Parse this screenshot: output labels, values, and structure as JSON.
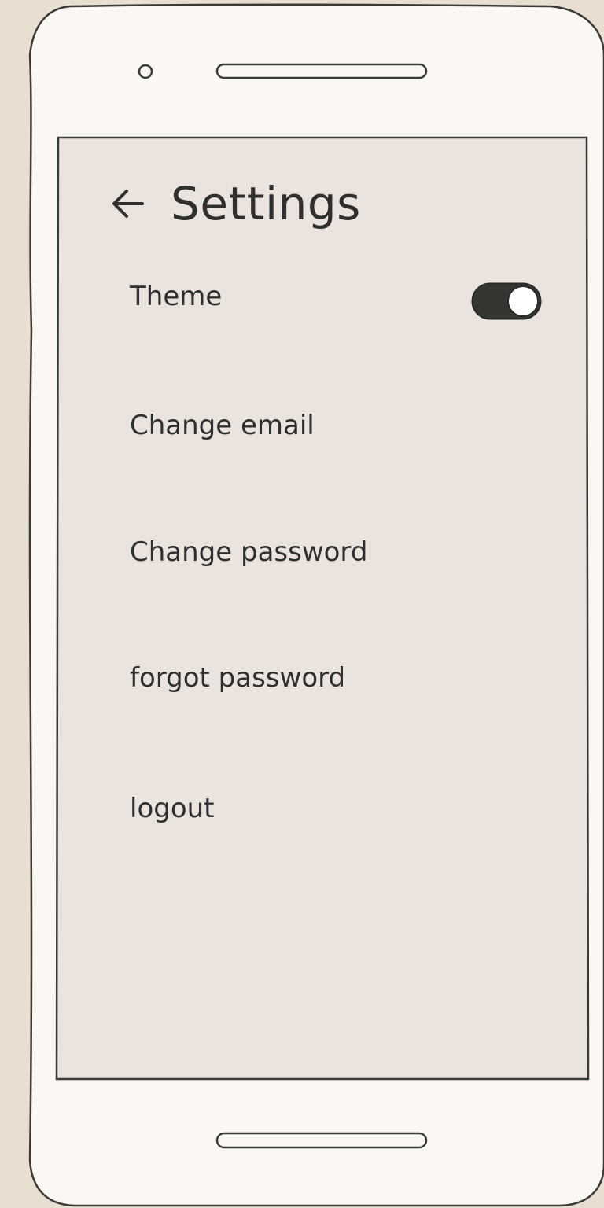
{
  "screen": {
    "title": "Settings",
    "back_icon": "arrow-left-icon",
    "items": [
      {
        "label": "Theme",
        "control": "toggle",
        "toggle_on": true
      },
      {
        "label": "Change email"
      },
      {
        "label": "Change password"
      },
      {
        "label": "forgot password"
      },
      {
        "label": "logout"
      }
    ]
  },
  "colors": {
    "page_background": "#e9dfd0",
    "phone_body": "#fbf8f4",
    "screen_background": "#ebe4de",
    "outline": "#3a3a36",
    "text": "#2f302d",
    "toggle_track": "#333631",
    "toggle_knob": "#ffffff"
  }
}
